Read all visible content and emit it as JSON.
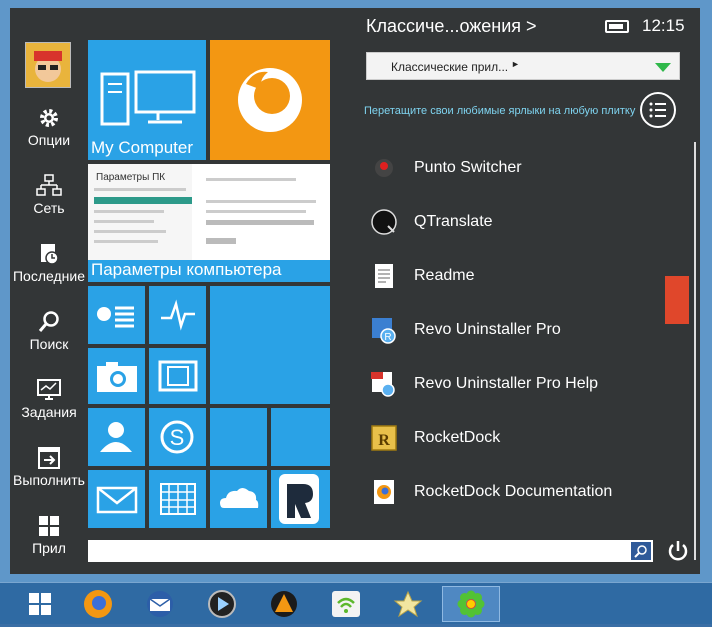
{
  "sidebar": {
    "items": [
      {
        "label": "Опции",
        "icon": "gear-icon"
      },
      {
        "label": "Сеть",
        "icon": "network-icon"
      },
      {
        "label": "Последние",
        "icon": "recent-icon"
      },
      {
        "label": "Поиск",
        "icon": "search-icon"
      },
      {
        "label": "Задания",
        "icon": "tasks-icon"
      },
      {
        "label": "Выполнить",
        "icon": "run-icon"
      },
      {
        "label": "Прил",
        "icon": "apps-icon"
      }
    ]
  },
  "tiles": {
    "my_computer": "My Computer",
    "pc_settings": "Параметры компьютера",
    "pc_settings_preview": "Параметры ПК",
    "accent": "#2aa2e6",
    "firefox_bg": "#f39712"
  },
  "header": {
    "title": "Классиче...ожения >",
    "clock": "12:15"
  },
  "category_select": {
    "value": "Классические прил..."
  },
  "hint": "Перетащите свои любимые ярлыки на любую плитку",
  "programs": [
    {
      "label": "Punto Switcher",
      "icon": "punto-switcher-icon"
    },
    {
      "label": "QTranslate",
      "icon": "qtranslate-icon"
    },
    {
      "label": "Readme",
      "icon": "document-icon"
    },
    {
      "label": "Revo Uninstaller Pro",
      "icon": "revo-uninstaller-icon"
    },
    {
      "label": "Revo Uninstaller Pro Help",
      "icon": "pdf-help-icon"
    },
    {
      "label": "RocketDock",
      "icon": "rocketdock-icon"
    },
    {
      "label": "RocketDock Documentation",
      "icon": "firefox-doc-icon"
    }
  ],
  "scrollbar": {
    "position": 0.38,
    "color": "#e0472b"
  },
  "search": {
    "value": ""
  },
  "taskbar": {
    "items": [
      "windows-start-icon",
      "firefox-icon",
      "thunderbird-icon",
      "media-player-icon",
      "aimp-icon",
      "wifi-icon",
      "star-icon",
      "icq-icon"
    ]
  }
}
